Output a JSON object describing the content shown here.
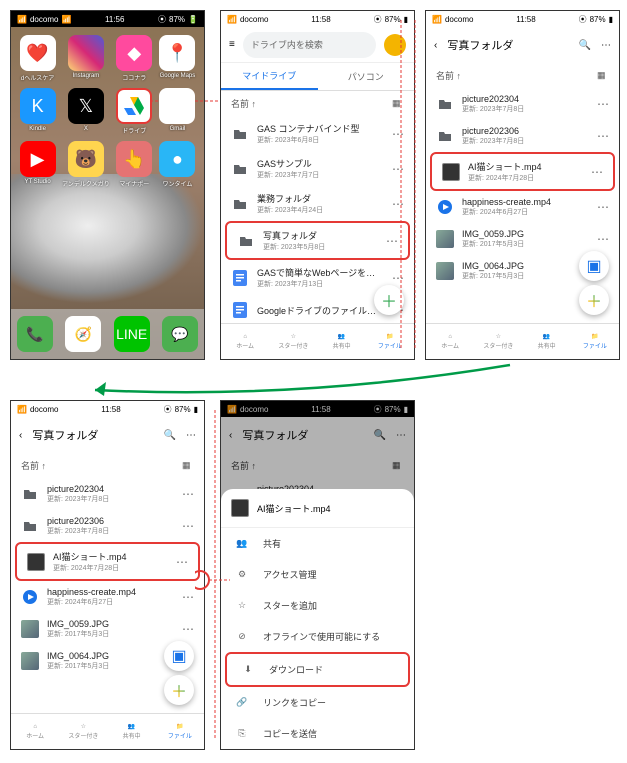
{
  "status": {
    "carrier": "docomo",
    "time1": "11:56",
    "time2": "11:58",
    "battery": "87%"
  },
  "home": {
    "apps_row1": [
      {
        "label": "dヘルスケア",
        "bg": "#fff",
        "emo": "❤️"
      },
      {
        "label": "Instagram",
        "bg": "linear-gradient(45deg,#feda75,#d62976,#4f5bd5)",
        "emo": ""
      },
      {
        "label": "ココナラ",
        "bg": "#ff4a9e",
        "emo": "◆"
      },
      {
        "label": "Google Maps",
        "bg": "#fff",
        "emo": "📍"
      }
    ],
    "apps_row2": [
      {
        "label": "Kindle",
        "bg": "#1a98ff",
        "emo": "K"
      },
      {
        "label": "X",
        "bg": "#000",
        "emo": "𝕏"
      },
      {
        "label": "ドライブ",
        "bg": "#fff",
        "emo": "△",
        "hl": true
      },
      {
        "label": "Gmail",
        "bg": "#fff",
        "emo": "M"
      }
    ],
    "apps_row3": [
      {
        "label": "YT Studio",
        "bg": "#f00",
        "emo": "▶"
      },
      {
        "label": "アンデルクメガり",
        "bg": "#ffd54f",
        "emo": "🐻"
      },
      {
        "label": "マイナポー",
        "bg": "#e57373",
        "emo": "👆"
      },
      {
        "label": "ワンタイム",
        "bg": "#29b6f6",
        "emo": "●"
      }
    ],
    "dock": [
      {
        "bg": "#4caf50",
        "emo": "📞"
      },
      {
        "bg": "#fff",
        "emo": "🧭"
      },
      {
        "bg": "#00c300",
        "emo": "LINE"
      },
      {
        "bg": "#4caf50",
        "emo": "💬"
      }
    ]
  },
  "drive": {
    "search_placeholder": "ドライブ内を検索",
    "tab_mydrive": "マイドライブ",
    "tab_pc": "パソコン",
    "sort_label": "名前 ↑",
    "folders": [
      {
        "name": "GAS コンテナバインド型",
        "date": "更新: 2023年6月8日",
        "type": "folder"
      },
      {
        "name": "GASサンプル",
        "date": "更新: 2023年7月7日",
        "type": "folder"
      },
      {
        "name": "業務フォルダ",
        "date": "更新: 2023年4月24日",
        "type": "folder"
      },
      {
        "name": "写真フォルダ",
        "date": "更新: 2023年5月8日",
        "type": "folder",
        "hl": true
      },
      {
        "name": "GASで簡単なWebページを…",
        "date": "更新: 2023年7月13日",
        "type": "doc"
      },
      {
        "name": "Googleドライブのファイル…",
        "date": "",
        "type": "doc"
      }
    ]
  },
  "photo_folder": {
    "title": "写真フォルダ",
    "sort_label": "名前 ↑",
    "files": [
      {
        "name": "picture202304",
        "date": "更新: 2023年7月8日",
        "type": "folder"
      },
      {
        "name": "picture202306",
        "date": "更新: 2023年7月8日",
        "type": "folder"
      },
      {
        "name": "AI猫ショート.mp4",
        "date": "更新: 2024年7月28日",
        "type": "video",
        "hl": true
      },
      {
        "name": "happiness-create.mp4",
        "date": "更新: 2024年6月27日",
        "type": "video2"
      },
      {
        "name": "IMG_0059.JPG",
        "date": "更新: 2017年5月3日",
        "type": "img"
      },
      {
        "name": "IMG_0064.JPG",
        "date": "更新: 2017年5月3日",
        "type": "img"
      }
    ]
  },
  "nav": {
    "home": "ホーム",
    "starred": "スター付き",
    "shared": "共有中",
    "files": "ファイル"
  },
  "sheet": {
    "file": "AI猫ショート.mp4",
    "items": [
      {
        "ico": "👥",
        "label": "共有"
      },
      {
        "ico": "⚙",
        "label": "アクセス管理"
      },
      {
        "ico": "☆",
        "label": "スターを追加"
      },
      {
        "ico": "⊘",
        "label": "オフラインで使用可能にする"
      },
      {
        "ico": "⬇",
        "label": "ダウンロード",
        "hl": true
      },
      {
        "ico": "🔗",
        "label": "リンクをコピー"
      },
      {
        "ico": "⎘",
        "label": "コピーを送信"
      }
    ]
  }
}
